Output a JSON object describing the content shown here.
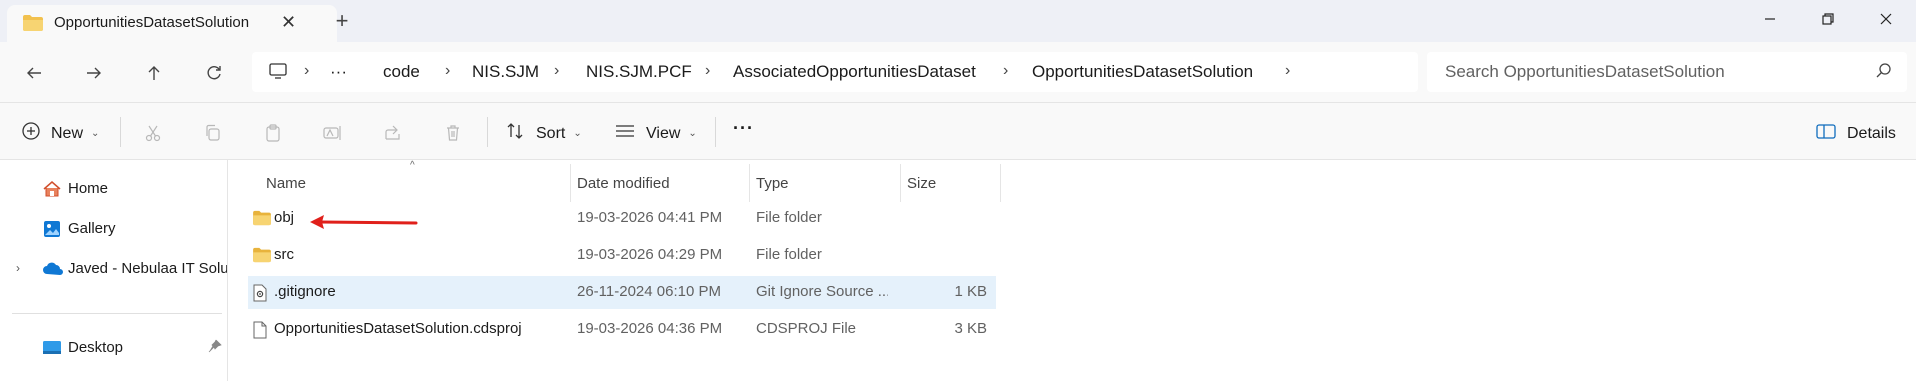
{
  "window": {
    "tab_title": "OpportunitiesDatasetSolution",
    "tab_close": "✕",
    "new_tab": "+"
  },
  "address": {
    "overflow": "···",
    "crumbs": [
      "code",
      "NIS.SJM",
      "NIS.SJM.PCF",
      "AssociatedOpportunitiesDataset",
      "OpportunitiesDatasetSolution"
    ],
    "chevron": "›"
  },
  "search": {
    "placeholder": "Search OpportunitiesDatasetSolution"
  },
  "toolbar": {
    "new_label": "New",
    "sort_label": "Sort",
    "view_label": "View",
    "more_label": "···",
    "details_label": "Details",
    "dropdown_caret": "⌄"
  },
  "sidebar": {
    "items": [
      {
        "label": "Home"
      },
      {
        "label": "Gallery"
      },
      {
        "label": "Javed - Nebulaa IT Solu"
      },
      {
        "label": "Desktop"
      }
    ],
    "expander": "›"
  },
  "columns": {
    "name": "Name",
    "date": "Date modified",
    "type": "Type",
    "size": "Size",
    "sort_caret": "^"
  },
  "files": [
    {
      "name": "obj",
      "date": "19-03-2026 04:41 PM",
      "type": "File folder",
      "size": "",
      "kind": "folder"
    },
    {
      "name": "src",
      "date": "19-03-2026 04:29 PM",
      "type": "File folder",
      "size": "",
      "kind": "folder"
    },
    {
      "name": ".gitignore",
      "date": "26-11-2024 06:10 PM",
      "type": "Git Ignore Source ...",
      "size": "1 KB",
      "kind": "gear-file",
      "selected": true
    },
    {
      "name": "OpportunitiesDatasetSolution.cdsproj",
      "date": "19-03-2026 04:36 PM",
      "type": "CDSPROJ File",
      "size": "3 KB",
      "kind": "file"
    }
  ],
  "colors": {
    "folder": "#f2c14e",
    "selected_row": "#e5f1fb",
    "annotation_arrow": "#e0201b",
    "onedrive": "#0f78d4"
  }
}
